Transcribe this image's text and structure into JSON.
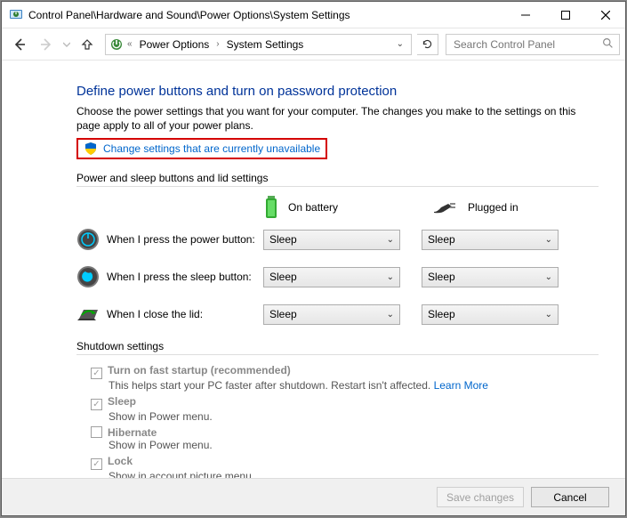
{
  "window": {
    "title": "Control Panel\\Hardware and Sound\\Power Options\\System Settings"
  },
  "breadcrumb": {
    "item1": "Power Options",
    "item2": "System Settings"
  },
  "search": {
    "placeholder": "Search Control Panel"
  },
  "page": {
    "heading": "Define power buttons and turn on password protection",
    "desc": "Choose the power settings that you want for your computer. The changes you make to the settings on this page apply to all of your power plans.",
    "uac_link": "Change settings that are currently unavailable"
  },
  "buttons_section": {
    "label": "Power and sleep buttons and lid settings",
    "col_battery": "On battery",
    "col_plugged": "Plugged in",
    "rows": [
      {
        "label": "When I press the power button:",
        "battery": "Sleep",
        "plugged": "Sleep"
      },
      {
        "label": "When I press the sleep button:",
        "battery": "Sleep",
        "plugged": "Sleep"
      },
      {
        "label": "When I close the lid:",
        "battery": "Sleep",
        "plugged": "Sleep"
      }
    ]
  },
  "shutdown": {
    "label": "Shutdown settings",
    "fast_startup": {
      "title": "Turn on fast startup (recommended)",
      "desc_prefix": "This helps start your PC faster after shutdown. Restart isn't affected. ",
      "learn_more": "Learn More",
      "checked": true
    },
    "sleep": {
      "title": "Sleep",
      "desc": "Show in Power menu.",
      "checked": true
    },
    "hibernate": {
      "title": "Hibernate",
      "desc": "Show in Power menu.",
      "checked": false
    },
    "lock": {
      "title": "Lock",
      "desc": "Show in account picture menu.",
      "checked": true
    }
  },
  "footer": {
    "save": "Save changes",
    "cancel": "Cancel"
  }
}
